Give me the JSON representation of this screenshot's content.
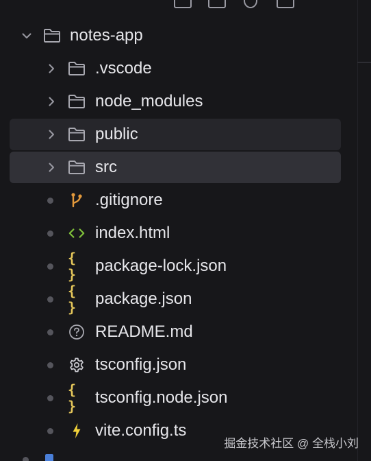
{
  "explorer": {
    "root": {
      "label": "notes-app",
      "icon": "folder-open-icon",
      "expanded": true
    },
    "items": [
      {
        "label": ".vscode",
        "type": "folder",
        "icon": "folder-icon"
      },
      {
        "label": "node_modules",
        "type": "folder",
        "icon": "folder-icon"
      },
      {
        "label": "public",
        "type": "folder",
        "icon": "folder-icon",
        "state": "hover"
      },
      {
        "label": "src",
        "type": "folder",
        "icon": "folder-icon",
        "state": "selected"
      },
      {
        "label": ".gitignore",
        "type": "file",
        "icon": "git-branch-icon"
      },
      {
        "label": "index.html",
        "type": "file",
        "icon": "html-code-icon"
      },
      {
        "label": "package-lock.json",
        "type": "file",
        "icon": "json-braces-icon"
      },
      {
        "label": "package.json",
        "type": "file",
        "icon": "json-braces-icon"
      },
      {
        "label": "README.md",
        "type": "file",
        "icon": "question-circle-icon"
      },
      {
        "label": "tsconfig.json",
        "type": "file",
        "icon": "gear-icon"
      },
      {
        "label": "tsconfig.node.json",
        "type": "file",
        "icon": "json-braces-icon"
      },
      {
        "label": "vite.config.ts",
        "type": "file",
        "icon": "lightning-icon"
      }
    ]
  },
  "watermark": "掘金技术社区 @ 全栈小刘",
  "colors": {
    "background": "#17171a",
    "selected_row": "#313137",
    "hover_row": "#26262b",
    "folder_icon": "#a8a8b0",
    "git_icon": "#e49a3c",
    "html_icon": "#7fbf3a",
    "json_icon": "#e3c55a",
    "vite_icon": "#f2d23a",
    "text": "#e6e6ea"
  }
}
